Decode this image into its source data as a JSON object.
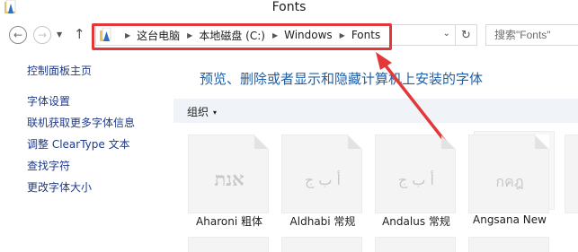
{
  "window": {
    "title": "Fonts"
  },
  "nav": {
    "back_glyph": "←",
    "forward_glyph": "→",
    "recent_glyph": "▼",
    "up_glyph": "↑",
    "refresh_glyph": "↻"
  },
  "address": {
    "breadcrumbs": [
      "这台电脑",
      "本地磁盘 (C:)",
      "Windows",
      "Fonts"
    ],
    "separator": "▶",
    "dropdown_glyph": "⌄",
    "highlight_color": "#e2383a"
  },
  "search": {
    "placeholder": "搜索\"Fonts\""
  },
  "sidebar": {
    "home_link": "控制面板主页",
    "links": [
      "字体设置",
      "联机获取更多字体信息",
      "调整 ClearType 文本",
      "查找字符",
      "更改字体大小"
    ]
  },
  "main": {
    "heading": "预览、删除或者显示和隐藏计算机上安装的字体",
    "organize_label": "组织",
    "organize_caret": "▾"
  },
  "fonts": [
    {
      "name": "Aharoni 粗体",
      "sample": "אנת"
    },
    {
      "name": "Aldhabi 常规",
      "sample": "أ ب ج"
    },
    {
      "name": "Andalus 常规",
      "sample": "أ ب ج"
    },
    {
      "name": "Angsana New",
      "sample": "กคฎ"
    }
  ],
  "icons": {
    "app": "folder-icon",
    "address": "folder-icon"
  }
}
